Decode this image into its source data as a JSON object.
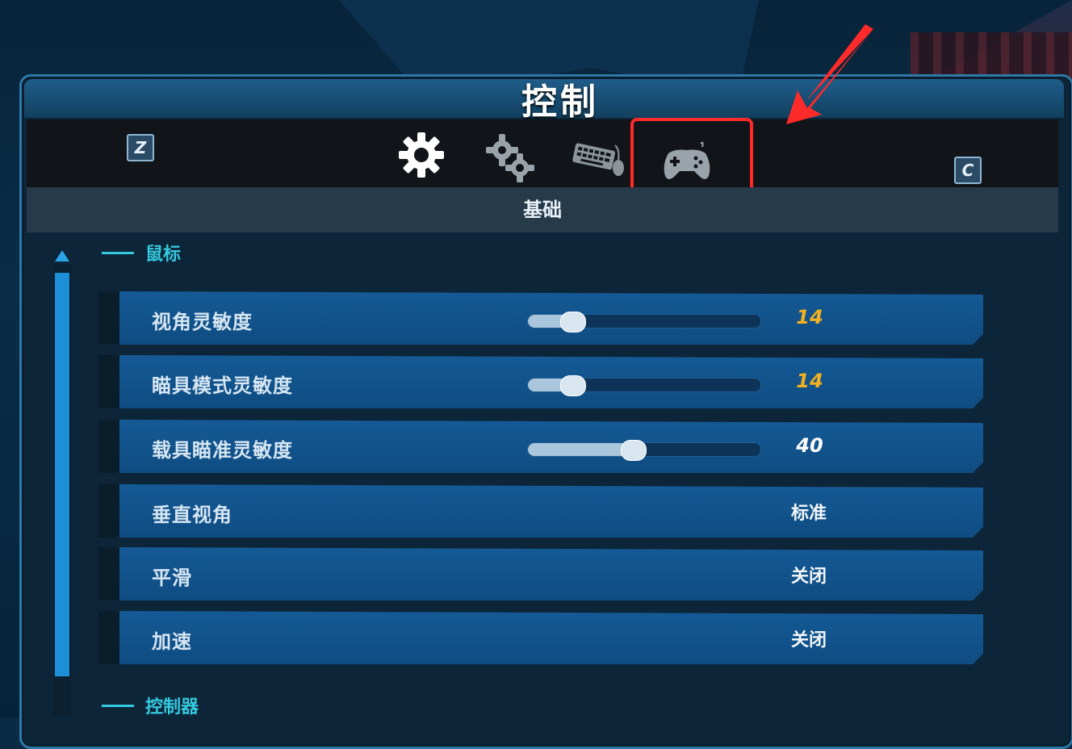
{
  "title": "控制",
  "tabbar": {
    "left_key": "Z",
    "right_key": "C",
    "tabs": [
      {
        "icon": "gear-icon",
        "active": true
      },
      {
        "icon": "gears-icon",
        "active": false
      },
      {
        "icon": "keyboard-mouse-icon",
        "active": false
      },
      {
        "icon": "gamepad-icon",
        "active": false,
        "highlighted": true
      }
    ]
  },
  "subtitle": "基础",
  "sections": {
    "mouse": "鼠标",
    "controller": "控制器"
  },
  "rows": [
    {
      "label": "视角灵敏度",
      "type": "slider",
      "value": "14",
      "value_color": "#f0b020",
      "fraction": 0.14
    },
    {
      "label": "瞄具模式灵敏度",
      "type": "slider",
      "value": "14",
      "value_color": "#f0b020",
      "fraction": 0.14
    },
    {
      "label": "载具瞄准灵敏度",
      "type": "slider",
      "value": "40",
      "value_color": "#ffffff",
      "fraction": 0.4
    },
    {
      "label": "垂直视角",
      "type": "option",
      "value": "标准"
    },
    {
      "label": "平滑",
      "type": "option",
      "value": "关闭"
    },
    {
      "label": "加速",
      "type": "option",
      "value": "关闭"
    }
  ],
  "colors": {
    "accent": "#35c8de",
    "highlight": "#ff2a2a",
    "row_bg": "#145a96"
  }
}
